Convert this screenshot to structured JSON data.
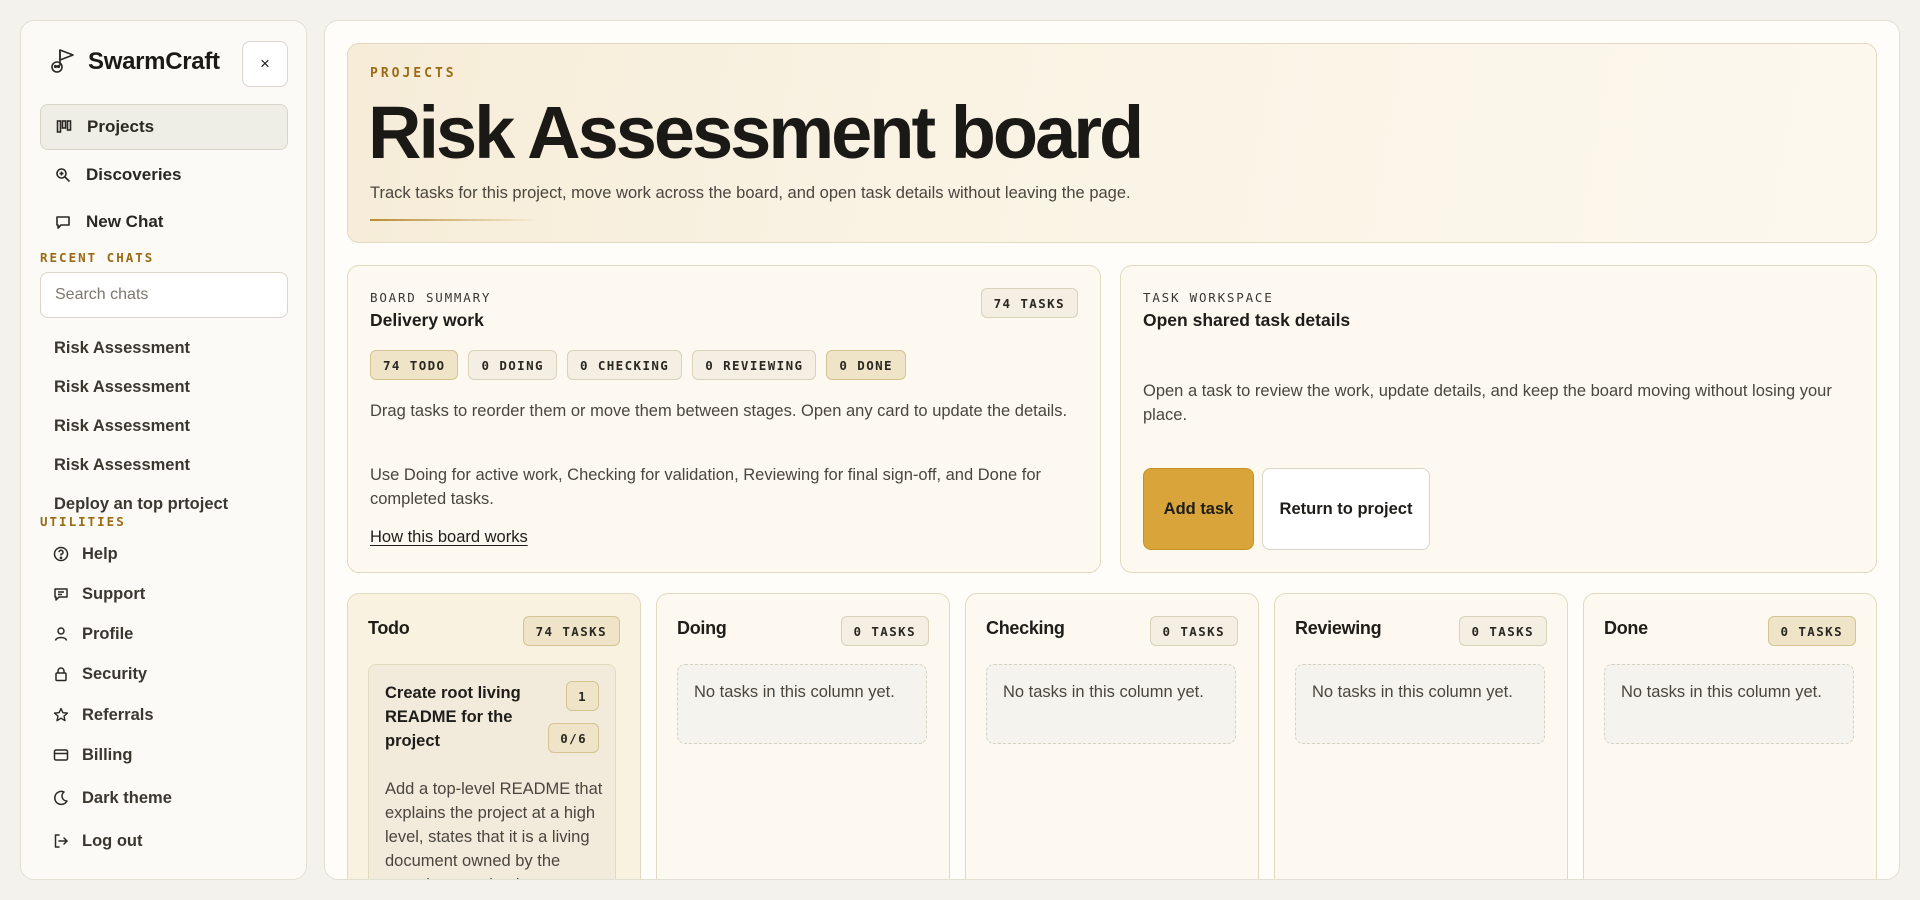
{
  "app": {
    "name": "SwarmCraft"
  },
  "sidebar": {
    "close_label": "×",
    "nav": [
      {
        "label": "Projects",
        "icon": "kanban-icon",
        "active": true
      },
      {
        "label": "Discoveries",
        "icon": "search-zoom-icon"
      },
      {
        "label": "New Chat",
        "icon": "chat-bubble-icon"
      }
    ],
    "recent_label": "RECENT CHATS",
    "search_placeholder": "Search chats",
    "chats": [
      "Risk Assessment",
      "Risk Assessment",
      "Risk Assessment",
      "Risk Assessment",
      "Deploy an top prtoject"
    ],
    "utilities_label": "UTILITIES",
    "utilities": [
      {
        "label": "Help",
        "icon": "help-circle-icon"
      },
      {
        "label": "Support",
        "icon": "message-square-icon"
      },
      {
        "label": "Profile",
        "icon": "user-icon"
      },
      {
        "label": "Security",
        "icon": "lock-icon"
      },
      {
        "label": "Referrals",
        "icon": "star-icon"
      },
      {
        "label": "Billing",
        "icon": "credit-card-icon"
      },
      {
        "label": "Dark theme",
        "icon": "moon-icon"
      },
      {
        "label": "Log out",
        "icon": "logout-icon"
      }
    ]
  },
  "hero": {
    "eyebrow": "PROJECTS",
    "title": "Risk Assessment board",
    "subtitle": "Track tasks for this project, move work across the board, and open task details without leaving the page."
  },
  "summary": {
    "eyebrow": "BOARD SUMMARY",
    "title": "Delivery work",
    "tasks_pill": "74 TASKS",
    "stages": [
      "74 TODO",
      "0 DOING",
      "0 CHECKING",
      "0 REVIEWING",
      "0 DONE"
    ],
    "text1": "Drag tasks to reorder them or move them between stages. Open any card to update the details.",
    "text2": "Use Doing for active work, Checking for validation, Reviewing for final sign-off, and Done for completed tasks.",
    "link": "How this board works"
  },
  "workspace": {
    "eyebrow": "TASK WORKSPACE",
    "title": "Open shared task details",
    "text": "Open a task to review the work, update details, and keep the board moving without losing your place.",
    "add_label": "Add task",
    "return_label": "Return to project"
  },
  "columns": [
    {
      "title": "Todo",
      "count": "74 TASKS"
    },
    {
      "title": "Doing",
      "count": "0 TASKS",
      "empty": "No tasks in this column yet."
    },
    {
      "title": "Checking",
      "count": "0 TASKS",
      "empty": "No tasks in this column yet."
    },
    {
      "title": "Reviewing",
      "count": "0 TASKS",
      "empty": "No tasks in this column yet."
    },
    {
      "title": "Done",
      "count": "0 TASKS",
      "empty": "No tasks in this column yet."
    }
  ],
  "task": {
    "title": "Create root living README for the project",
    "number": "1",
    "progress": "0/6",
    "description": "Add a top-level README that explains the project at a high level, states that it is a living document owned by the repository, and points"
  },
  "colors": {
    "accent": "#d9a53a",
    "eyebrow": "#9a6b12",
    "pill_bg": "#efe4c7"
  }
}
